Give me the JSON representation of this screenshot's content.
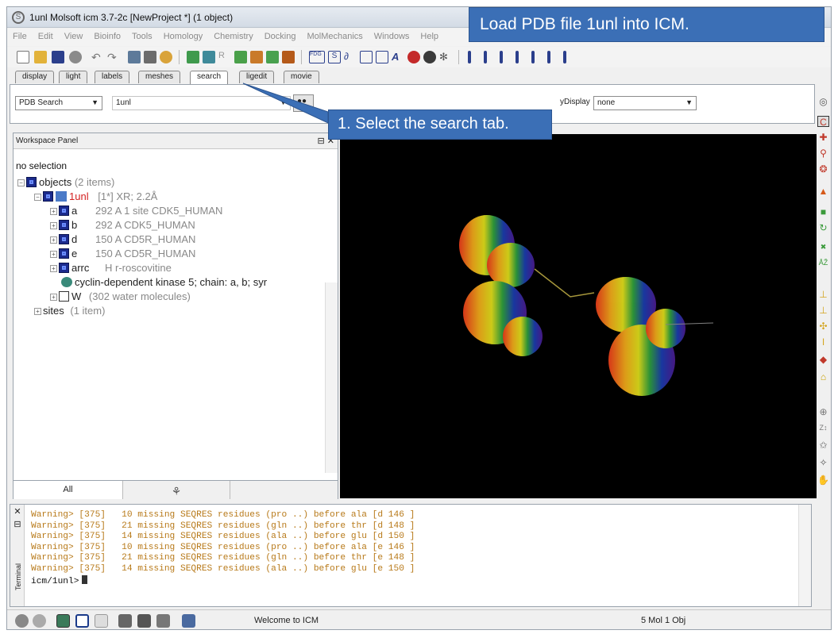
{
  "window": {
    "title": "1unl Molsoft icm 3.7-2c  [NewProject *] (1 object)"
  },
  "banner": {
    "text": "Load PDB file 1unl into ICM."
  },
  "callout": {
    "text": "1. Select the search tab."
  },
  "menu": [
    "File",
    "Edit",
    "View",
    "Bioinfo",
    "Tools",
    "Homology",
    "Chemistry",
    "Docking",
    "MolMechanics",
    "Windows",
    "Help"
  ],
  "tabs": [
    "display",
    "light",
    "labels",
    "meshes",
    "search",
    "ligedit",
    "movie"
  ],
  "active_tab": "search",
  "search": {
    "source": "PDB Search",
    "query": "1unl",
    "display_label": "yDisplay",
    "display_value": "none"
  },
  "workspace": {
    "title": "Workspace Panel",
    "selection": "no selection",
    "tree": {
      "objects_label": "objects",
      "objects_count": "(2 items)",
      "object_name": "1unl",
      "object_info": "[1*] XR; 2.2Å",
      "molecules": [
        {
          "name": "a",
          "info": "292 A  1 site CDK5_HUMAN"
        },
        {
          "name": "b",
          "info": "292 A  CDK5_HUMAN"
        },
        {
          "name": "d",
          "info": "150 A  CD5R_HUMAN"
        },
        {
          "name": "e",
          "info": "150 A  CD5R_HUMAN"
        },
        {
          "name": "arrc",
          "info": "H  r-roscovitine"
        }
      ],
      "description": "cyclin-dependent kinase 5; chain: a, b; syr",
      "water_name": "W",
      "water_info": "(302 water molecules)",
      "sites_label": "sites",
      "sites_count": "(1 item)"
    },
    "bottom_tabs": [
      "All"
    ]
  },
  "terminal": {
    "label": "Terminal",
    "lines": [
      "Warning> [375]   10 missing SEQRES residues (pro ..) before ala [d 146 ]",
      "Warning> [375]   21 missing SEQRES residues (gln ..) before thr [d 148 ]",
      "Warning> [375]   14 missing SEQRES residues (ala ..) before glu [d 150 ]",
      "Warning> [375]   10 missing SEQRES residues (pro ..) before ala [e 146 ]",
      "Warning> [375]   21 missing SEQRES residues (gln ..) before thr [e 148 ]",
      "Warning> [375]   14 missing SEQRES residues (ala ..) before glu [e 150 ]"
    ],
    "prompt": "icm/1unl>"
  },
  "status": {
    "message": "Welcome to ICM",
    "counts": "5 Mol 1 Obj"
  },
  "colors": {
    "accent": "#3b6fb6",
    "warning_text": "#b87a1a",
    "object_red": "#d42020",
    "viewer_bg": "#000000"
  }
}
